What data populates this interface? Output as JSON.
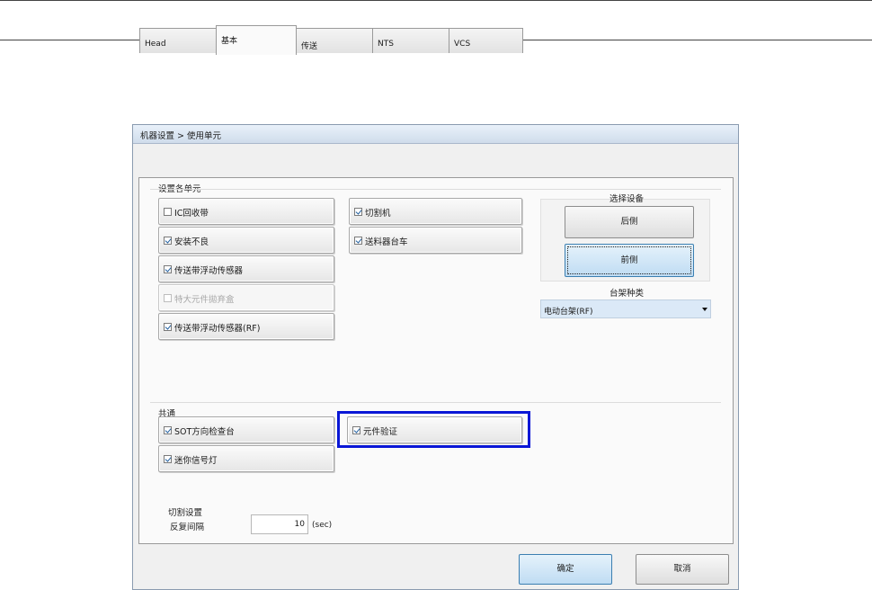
{
  "window": {
    "title": "机器设置 > 使用单元"
  },
  "tabs": [
    {
      "label": "Head",
      "active": false
    },
    {
      "label": "基本",
      "active": true
    },
    {
      "label": "传送",
      "active": false
    },
    {
      "label": "NTS",
      "active": false
    },
    {
      "label": "VCS",
      "active": false
    }
  ],
  "unit_settings": {
    "group_label": "设置各单元",
    "left_items": [
      {
        "label": "IC回收带",
        "checked": false,
        "enabled": true
      },
      {
        "label": "安装不良",
        "checked": true,
        "enabled": true
      },
      {
        "label": "传送带浮动传感器",
        "checked": true,
        "enabled": true
      },
      {
        "label": "特大元件拋弃盒",
        "checked": false,
        "enabled": false
      },
      {
        "label": "传送带浮动传感器(RF)",
        "checked": true,
        "enabled": true
      }
    ],
    "right_items": [
      {
        "label": "切割机",
        "checked": true,
        "enabled": true
      },
      {
        "label": "送料器台车",
        "checked": true,
        "enabled": true
      }
    ]
  },
  "device_select": {
    "label": "选择设备",
    "rear_button": "后侧",
    "front_button": "前侧",
    "focused": "前侧"
  },
  "rack_type": {
    "label": "台架种类",
    "selected": "电动台架(RF)"
  },
  "common": {
    "group_label": "共通",
    "items": [
      {
        "label": "SOT方向检查台",
        "checked": true
      },
      {
        "label": "迷你信号灯",
        "checked": true
      },
      {
        "label": "元件验证",
        "checked": true,
        "highlighted": true
      }
    ]
  },
  "cut_settings": {
    "group_label": "切割设置",
    "interval_label": "反复间隔",
    "interval_value": "10",
    "interval_unit": "(sec)"
  },
  "footer": {
    "ok_label": "确定",
    "cancel_label": "取消"
  },
  "colors": {
    "highlight_border": "#0a17d6",
    "focused_button": "#bfdcf3",
    "combo_selected": "#dbe9f7"
  }
}
